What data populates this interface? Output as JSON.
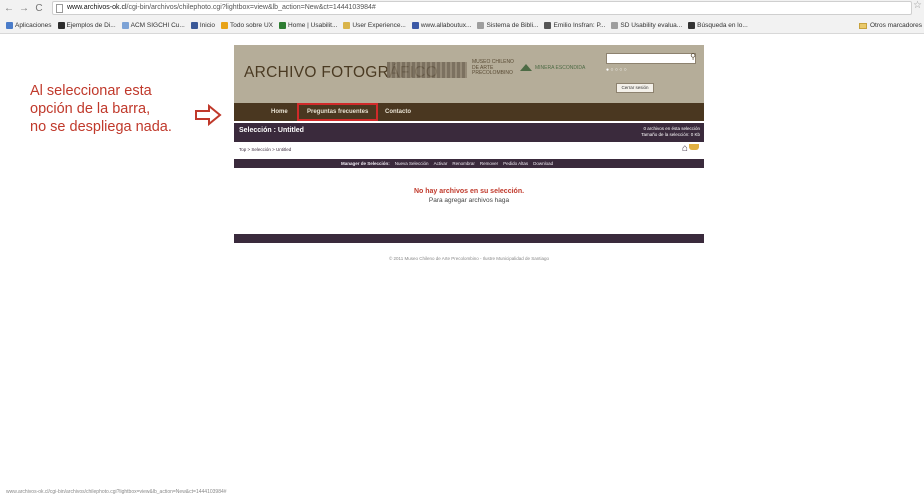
{
  "browser": {
    "url_domain": "www.archivos-ok.cl",
    "url_path": "/cgi-bin/archivos/chilephoto.cgi?lightbox=view&lb_action=New&ct=1444103984#",
    "bookmarks": [
      {
        "label": "Aplicaciones",
        "color": "#4a7cc9"
      },
      {
        "label": "Ejemplos de Di...",
        "color": "#2c2c2c"
      },
      {
        "label": "ACM SIGCHI Cu...",
        "color": "#7da3d6"
      },
      {
        "label": "Inicio",
        "color": "#3b5998"
      },
      {
        "label": "Todo sobre UX",
        "color": "#e8a317"
      },
      {
        "label": "Home | Usabilit...",
        "color": "#2e7d32"
      },
      {
        "label": "User Experience...",
        "color": "#d9b44a"
      },
      {
        "label": "www.allaboutux...",
        "color": "#3c5aa6"
      },
      {
        "label": "Sistema de Bibli...",
        "color": "#9e9e9e"
      },
      {
        "label": "Emilio Insfran: P...",
        "color": "#555555"
      },
      {
        "label": "SD Usability evalua...",
        "color": "#9e9e9e"
      },
      {
        "label": "Búsqueda en lo...",
        "color": "#333333"
      }
    ],
    "other_bookmarks": "Otros marcadores",
    "status_url": "www.archivos-ok.cl/cgi-bin/archivos/chilephoto.cgi?lightbox=view&lb_action=New&ct=1444103984#"
  },
  "annotation": {
    "line1": "Al seleccionar esta",
    "line2": "opción de la barra,",
    "line3": "no se despliega nada.",
    "color": "#c0392b"
  },
  "site": {
    "title": "ARCHIVO FOTOGRÁFICO",
    "museo_logo": [
      "MUSEO CHILENO",
      "DE ARTE",
      "PRECOLOMBINO"
    ],
    "minera_logo": "MINERA ESCONDIDA",
    "logout_label": "Cerrar sesión",
    "nav": {
      "home": "Home",
      "faq": "Preguntas frecuentes",
      "contact": "Contacto"
    },
    "selection": {
      "title": "Selección : Untitled",
      "info_line1": "0 archivos en ésta selección",
      "info_line2": "Tamaño de la selección: 0 Kb",
      "breadcrumb": "Top > Selección > Untitled"
    },
    "manager": {
      "label": "Manager de Selección:",
      "items": [
        "Nueva Selección",
        "Activar",
        "Renombrar",
        "Remover",
        "Pedido Altas",
        "Download"
      ]
    },
    "empty_title": "No hay archivos en su selección.",
    "empty_sub": "Para agregar archivos haga",
    "copyright": "© 2011 Museo Chileno de Arte Precolombino - Ilustre Municipalidad de Santiago"
  }
}
